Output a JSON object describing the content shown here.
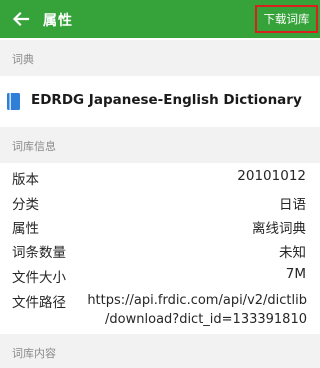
{
  "appbar": {
    "title": "属性",
    "download_label": "下载词库"
  },
  "sections": {
    "dict": "词典",
    "info": "词库信息",
    "content": "词库内容"
  },
  "dictionary": {
    "name": "EDRDG Japanese-English Dictionary",
    "icon": "book-icon"
  },
  "info": {
    "version_label": "版本",
    "version_value": "20101012",
    "category_label": "分类",
    "category_value": "日语",
    "attribute_label": "属性",
    "attribute_value": "离线词典",
    "entries_label": "词条数量",
    "entries_value": "未知",
    "size_label": "文件大小",
    "size_value": "7M",
    "path_label": "文件路径",
    "path_line1": "https://api.frdic.com/api/v2/dictlib",
    "path_line2": "/download?dict_id=133391810"
  },
  "colors": {
    "appbar": "#36a23a",
    "highlight_border": "#d9201f",
    "book_icon": "#2f7fd8",
    "section_bg": "#f2f2f2"
  }
}
